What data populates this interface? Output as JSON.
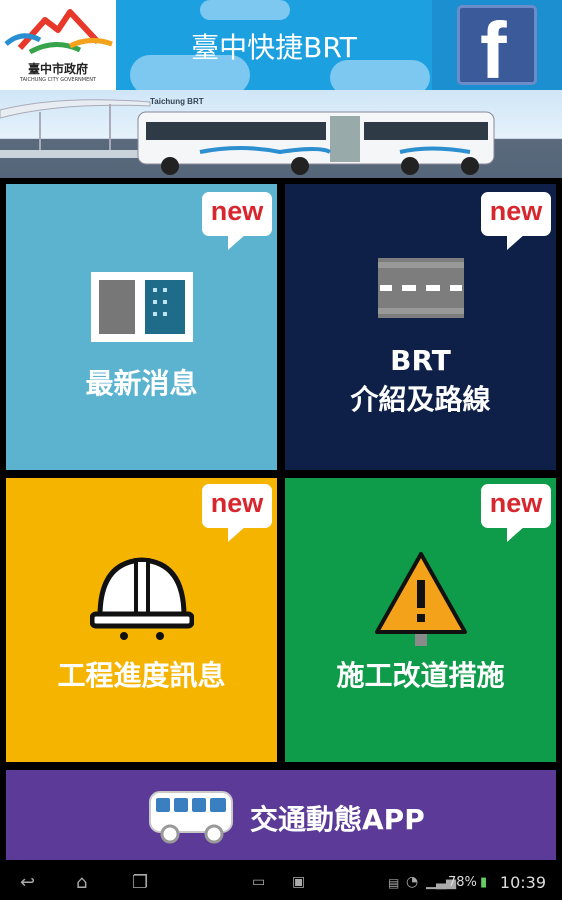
{
  "header": {
    "logo_text": "臺中市政府",
    "logo_sub": "TAICHUNG CITY GOVERNMENT",
    "title": "臺中快捷BRT",
    "facebook_icon": "facebook-icon"
  },
  "banner": {
    "bus_sign": "Taichung BRT"
  },
  "tiles": [
    {
      "label": "最新消息",
      "badge": "new",
      "icon": "news-panel-icon",
      "color": "#5cb3d0"
    },
    {
      "label_line1": "BRT",
      "label_line2": "介紹及路線",
      "badge": "new",
      "icon": "road-icon",
      "color": "#0e2048"
    },
    {
      "label": "工程進度訊息",
      "badge": "new",
      "icon": "hard-hat-icon",
      "color": "#f5b400"
    },
    {
      "label": "施工改道措施",
      "badge": "new",
      "icon": "warning-sign-icon",
      "color": "#0e9c4a"
    }
  ],
  "app_button": {
    "label": "交通動態APP",
    "icon": "bus-icon",
    "color": "#5b3b97"
  },
  "status_bar": {
    "battery": "78%",
    "time": "10:39"
  }
}
